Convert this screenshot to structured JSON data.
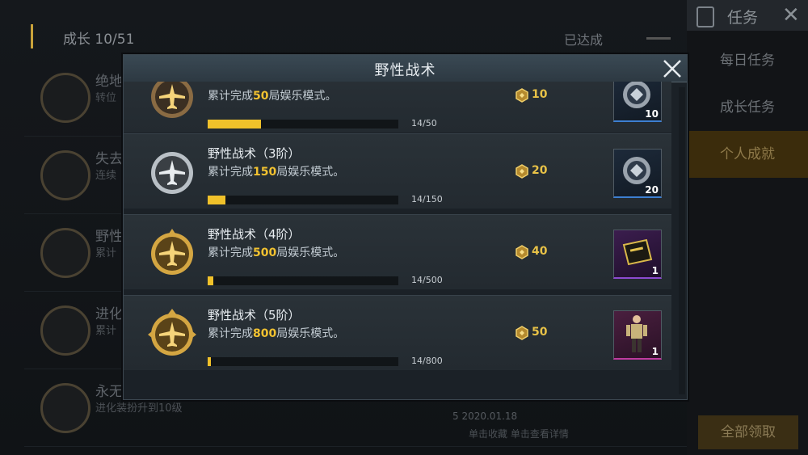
{
  "background": {
    "growth_label": "成长",
    "growth_count": "10/51",
    "achieved_label": "已达成",
    "rows": [
      {
        "label": "绝地",
        "sub": "转位"
      },
      {
        "label": "失去",
        "sub": "连续"
      },
      {
        "label": "野性",
        "sub": "累计"
      },
      {
        "label": "进化",
        "sub": "累计"
      },
      {
        "label": "永无",
        "sub": "进化装扮升到10级"
      }
    ],
    "bottom_info_1": "5      2020.01.18",
    "bottom_info_2": "单击收藏 单击查看详情"
  },
  "sidebar": {
    "title": "任务",
    "tabs": [
      "每日任务",
      "成长任务",
      "个人成就"
    ],
    "active_tab": 2,
    "claim_all": "全部领取"
  },
  "modal": {
    "title": "野性战术",
    "accent_color": "#f0c12a",
    "tasks": [
      {
        "name": "",
        "desc_prefix": "累计完成",
        "desc_target": "50",
        "desc_suffix": "局娱乐模式。",
        "progress_text": "14/50",
        "progress": 0.28,
        "coins": "10",
        "reward_count": "10",
        "reward_type": "badge",
        "emblem": "bronze"
      },
      {
        "name": "野性战术（3阶）",
        "desc_prefix": "累计完成",
        "desc_target": "150",
        "desc_suffix": "局娱乐模式。",
        "progress_text": "14/150",
        "progress": 0.093,
        "coins": "20",
        "reward_count": "20",
        "reward_type": "badge",
        "emblem": "silver"
      },
      {
        "name": "野性战术（4阶）",
        "desc_prefix": "累计完成",
        "desc_target": "500",
        "desc_suffix": "局娱乐模式。",
        "progress_text": "14/500",
        "progress": 0.028,
        "coins": "40",
        "reward_count": "1",
        "reward_type": "ticket",
        "emblem": "gold"
      },
      {
        "name": "野性战术（5阶）",
        "desc_prefix": "累计完成",
        "desc_target": "800",
        "desc_suffix": "局娱乐模式。",
        "progress_text": "14/800",
        "progress": 0.0175,
        "coins": "50",
        "reward_count": "1",
        "reward_type": "outfit",
        "emblem": "gold-wing"
      }
    ]
  }
}
